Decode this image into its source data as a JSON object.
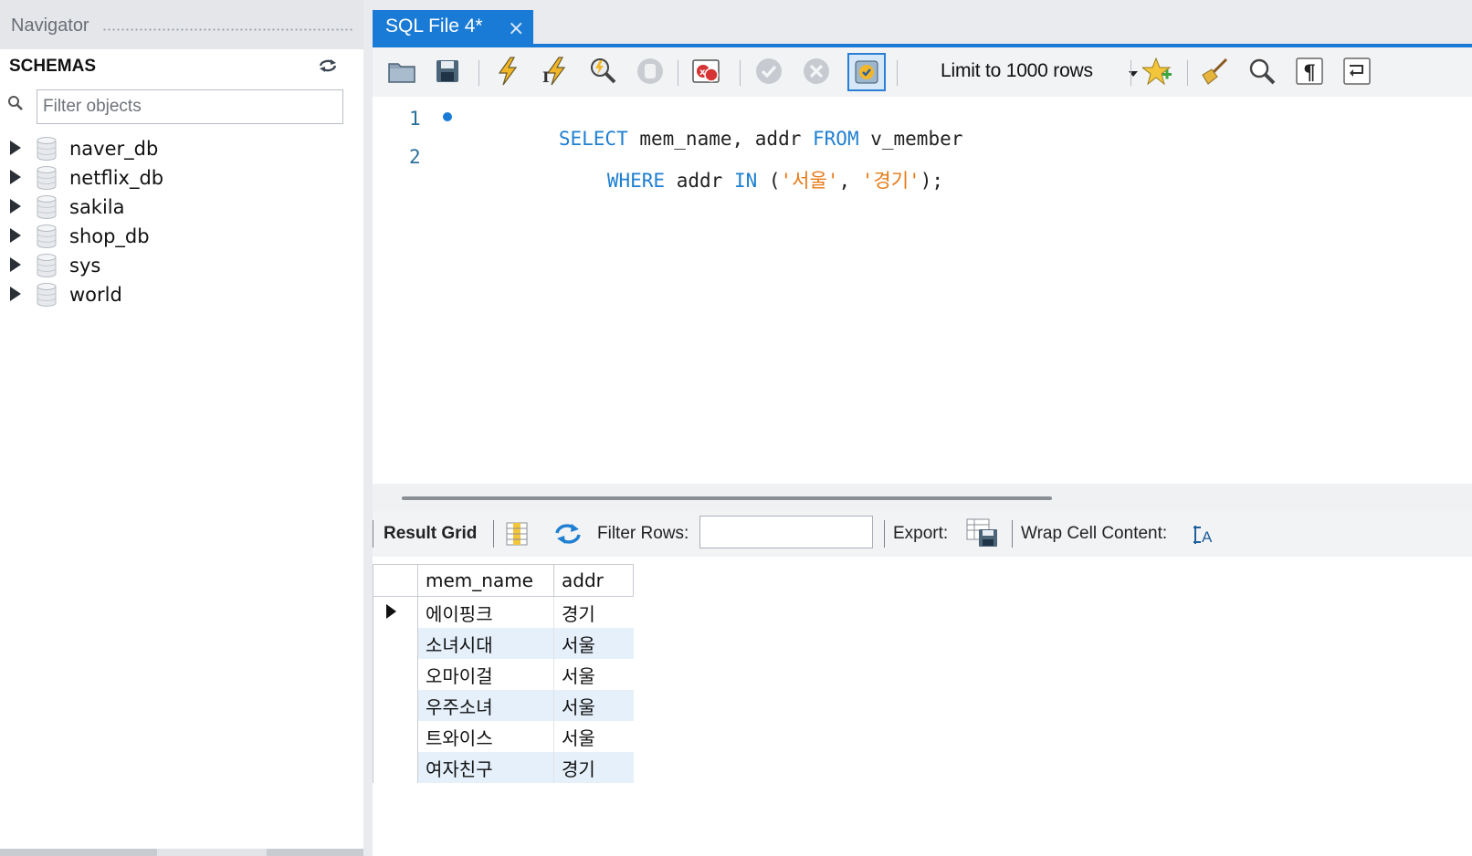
{
  "navigator": {
    "title": "Navigator",
    "schemas_header": "SCHEMAS",
    "filter_placeholder": "Filter objects",
    "schemas": [
      "naver_db",
      "netflix_db",
      "sakila",
      "shop_db",
      "sys",
      "world"
    ]
  },
  "editor_tab": {
    "label": "SQL File 4*",
    "close": "×"
  },
  "toolbar": {
    "limit_label": "Limit to 1000 rows"
  },
  "editor": {
    "lines": [
      {
        "number": "1",
        "tokens": [
          {
            "text": "SELECT",
            "kind": "kw"
          },
          {
            "text": " mem_name, addr ",
            "kind": "id"
          },
          {
            "text": "FROM",
            "kind": "kw"
          },
          {
            "text": " v_member",
            "kind": "id"
          }
        ]
      },
      {
        "number": "2",
        "tokens": [
          {
            "text": "WHERE",
            "kind": "kw"
          },
          {
            "text": " addr ",
            "kind": "id"
          },
          {
            "text": "IN",
            "kind": "kw"
          },
          {
            "text": " (",
            "kind": "id"
          },
          {
            "text": "'서울'",
            "kind": "str"
          },
          {
            "text": ", ",
            "kind": "id"
          },
          {
            "text": "'경기'",
            "kind": "str"
          },
          {
            "text": ");",
            "kind": "id"
          }
        ]
      }
    ]
  },
  "result": {
    "result_grid_label": "Result Grid",
    "filter_rows_label": "Filter Rows:",
    "export_label": "Export:",
    "wrap_label": "Wrap Cell Content:",
    "columns": [
      "mem_name",
      "addr"
    ],
    "rows": [
      [
        "에이핑크",
        "경기"
      ],
      [
        "소녀시대",
        "서울"
      ],
      [
        "오마이걸",
        "서울"
      ],
      [
        "우주소녀",
        "서울"
      ],
      [
        "트와이스",
        "서울"
      ],
      [
        "여자친구",
        "경기"
      ]
    ]
  },
  "colors": {
    "accent": "#1a7bd6",
    "keyword": "#1f7fd1",
    "string": "#e77a17",
    "row_alt": "#e5f0fb"
  }
}
